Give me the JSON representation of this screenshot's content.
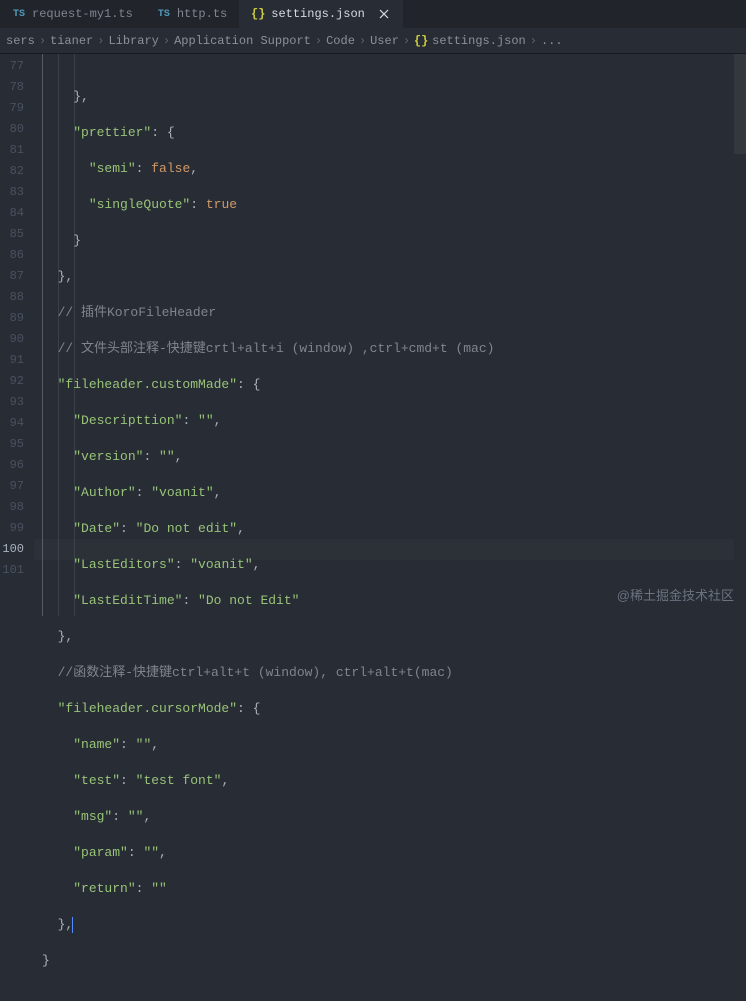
{
  "tabs": [
    {
      "label": "request-my1.ts",
      "icon": "TS",
      "active": false
    },
    {
      "label": "http.ts",
      "icon": "TS",
      "active": false
    },
    {
      "label": "settings.json",
      "icon": "{}",
      "active": true
    }
  ],
  "breadcrumbs": {
    "items": [
      "sers",
      "tianer",
      "Library",
      "Application Support",
      "Code",
      "User",
      "settings.json"
    ],
    "file_icon": "{}",
    "ellipsis": "..."
  },
  "line_numbers": [
    "77",
    "78",
    "79",
    "80",
    "81",
    "82",
    "83",
    "84",
    "85",
    "86",
    "87",
    "88",
    "89",
    "90",
    "91",
    "92",
    "93",
    "94",
    "95",
    "96",
    "97",
    "98",
    "99",
    "100",
    "101"
  ],
  "current_line": "100",
  "code": {
    "l77": "    },",
    "l78_key": "\"prettier\"",
    "l78_rest": ": {",
    "l79_key": "\"semi\"",
    "l79_sep": ": ",
    "l79_val": "false",
    "l79_end": ",",
    "l80_key": "\"singleQuote\"",
    "l80_sep": ": ",
    "l80_val": "true",
    "l81": "    }",
    "l82": "  },",
    "l83": "  // 插件KoroFileHeader",
    "l84": "  // 文件头部注释-快捷键crtl+alt+i (window) ,ctrl+cmd+t (mac)",
    "l85_key": "\"fileheader.customMade\"",
    "l85_rest": ": {",
    "l86_key": "\"Descripttion\"",
    "l86_val": "\"\"",
    "l87_key": "\"version\"",
    "l87_val": "\"\"",
    "l88_key": "\"Author\"",
    "l88_val": "\"voanit\"",
    "l89_key": "\"Date\"",
    "l89_val": "\"Do not edit\"",
    "l90_key": "\"LastEditors\"",
    "l90_val": "\"voanit\"",
    "l91_key": "\"LastEditTime\"",
    "l91_val": "\"Do not Edit\"",
    "l92": "  },",
    "l93": "  //函数注释-快捷键ctrl+alt+t (window), ctrl+alt+t(mac)",
    "l94_key": "\"fileheader.cursorMode\"",
    "l94_rest": ": {",
    "l95_key": "\"name\"",
    "l95_val": "\"\"",
    "l96_key": "\"test\"",
    "l96_val": "\"test font\"",
    "l97_key": "\"msg\"",
    "l97_val": "\"\"",
    "l98_key": "\"param\"",
    "l98_val": "\"\"",
    "l99_key": "\"return\"",
    "l99_val": "\"\"",
    "l100": "  },",
    "l101": "}"
  },
  "watermark": "@稀土掘金技术社区"
}
